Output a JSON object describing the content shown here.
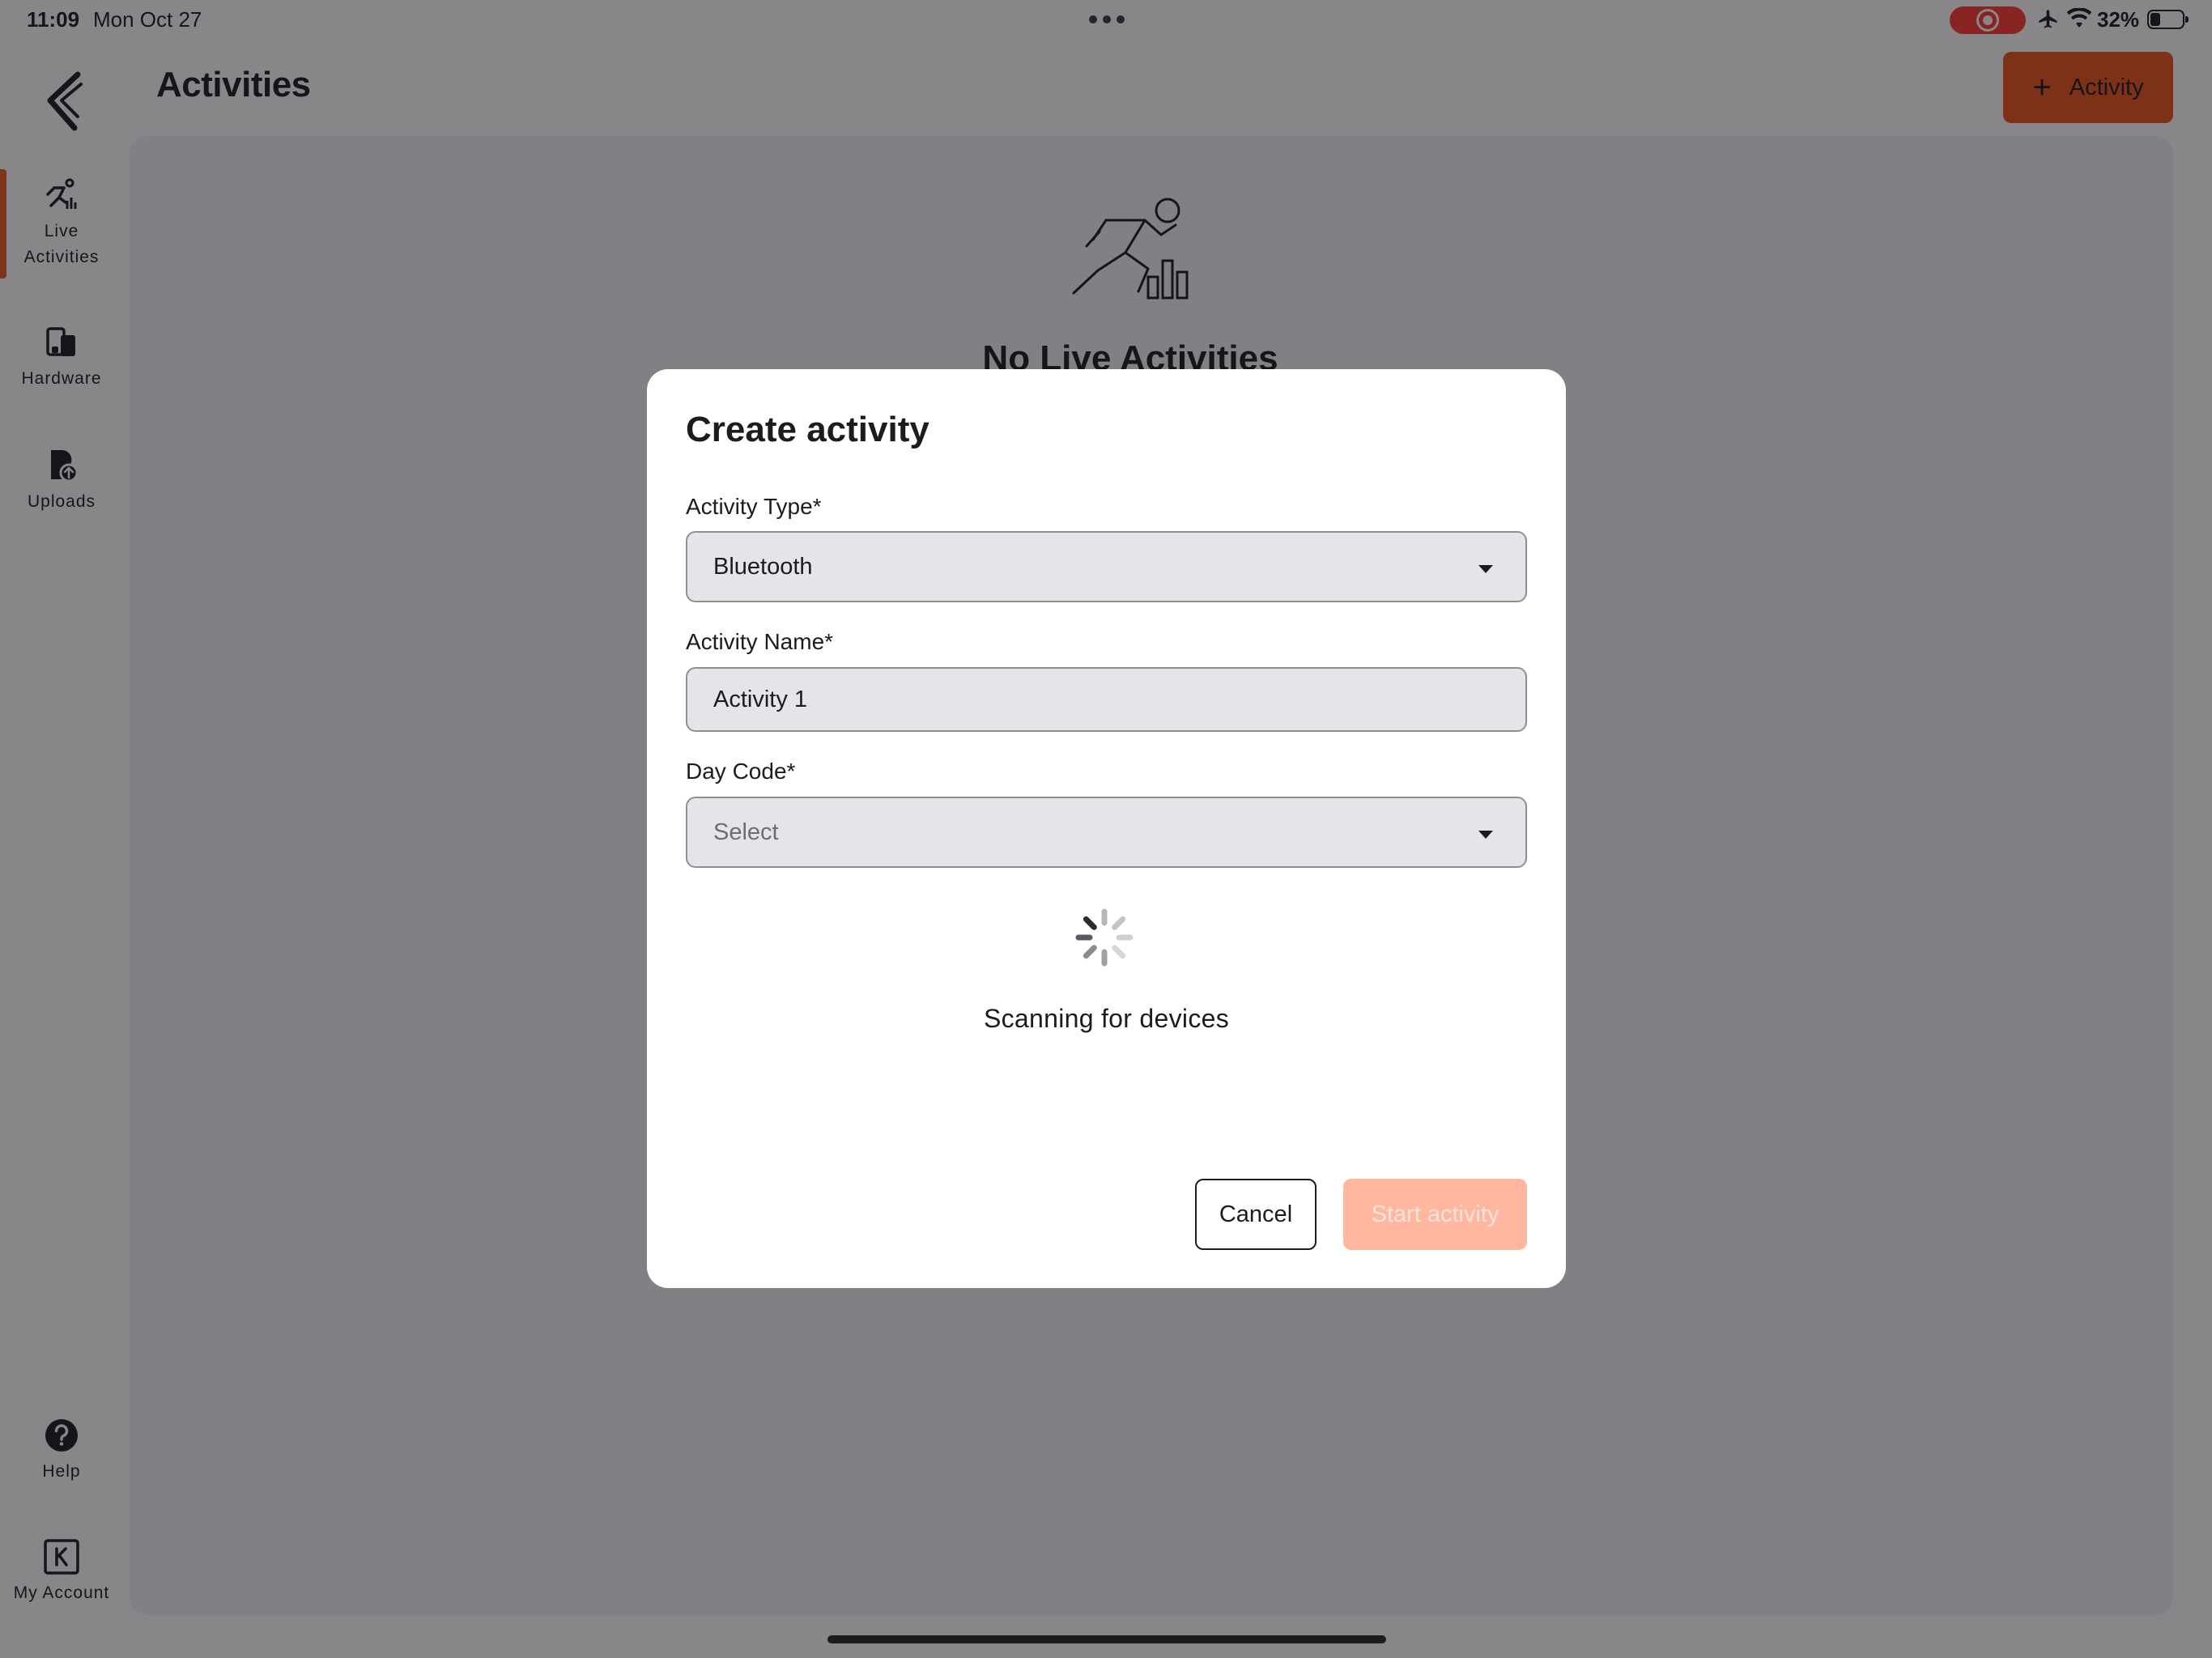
{
  "status_bar": {
    "time": "11:09",
    "date": "Mon Oct 27",
    "battery": "32%",
    "icons": [
      "screen-recording-icon",
      "airplane-icon",
      "wifi-icon",
      "battery-icon"
    ]
  },
  "sidebar": {
    "items": [
      {
        "label": "Live\nActivities",
        "icon": "runner-icon",
        "active": true
      },
      {
        "label": "Hardware",
        "icon": "devices-icon",
        "active": false
      },
      {
        "label": "Uploads",
        "icon": "upload-icon",
        "active": false
      },
      {
        "label": "Help",
        "icon": "help-icon",
        "active": false
      },
      {
        "label": "My Account",
        "icon": "account-icon",
        "active": false
      }
    ]
  },
  "header": {
    "title": "Activities",
    "add_button_label": "Activity"
  },
  "empty_state": {
    "title": "No Live Activities"
  },
  "modal": {
    "title": "Create activity",
    "activity_type": {
      "label": "Activity Type*",
      "value": "Bluetooth"
    },
    "activity_name": {
      "label": "Activity Name*",
      "value": "Activity 1"
    },
    "day_code": {
      "label": "Day Code*",
      "placeholder": "Select"
    },
    "status_text": "Scanning for devices",
    "cancel_label": "Cancel",
    "start_label": "Start activity"
  },
  "colors": {
    "accent": "#e8561b",
    "accent_disabled": "#ffb79f",
    "panel": "#f3f3f5",
    "field_bg": "#e5e4e8"
  }
}
